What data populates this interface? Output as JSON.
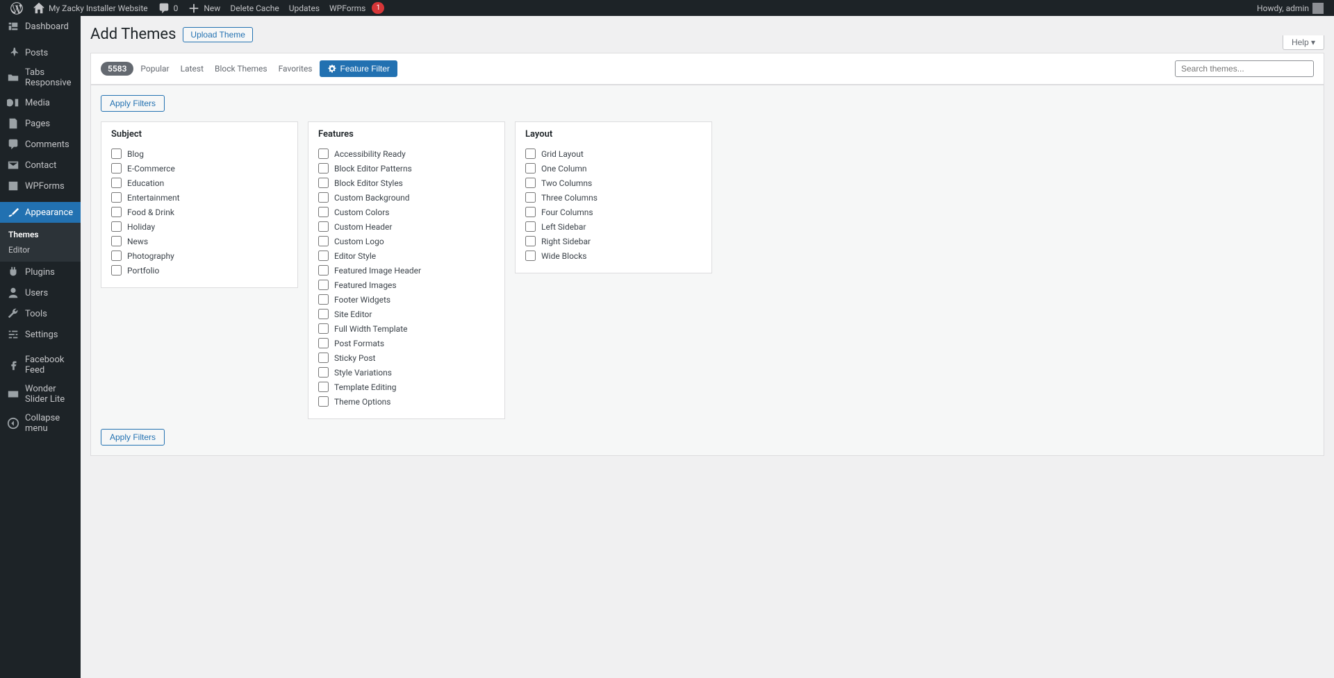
{
  "adminbar": {
    "site_name": "My Zacky Installer Website",
    "comments_count": "0",
    "new": "New",
    "delete_cache": "Delete Cache",
    "updates": "Updates",
    "wpforms": "WPForms",
    "wpforms_badge": "1",
    "howdy": "Howdy, admin"
  },
  "sidebar": {
    "dashboard": "Dashboard",
    "posts": "Posts",
    "tabs_responsive": "Tabs Responsive",
    "media": "Media",
    "pages": "Pages",
    "comments": "Comments",
    "contact": "Contact",
    "wpforms": "WPForms",
    "appearance": "Appearance",
    "appearance_sub": {
      "themes": "Themes",
      "editor": "Editor"
    },
    "plugins": "Plugins",
    "users": "Users",
    "tools": "Tools",
    "settings": "Settings",
    "facebook_feed": "Facebook Feed",
    "wonder_slider": "Wonder Slider Lite",
    "collapse": "Collapse menu"
  },
  "header": {
    "title": "Add Themes",
    "upload": "Upload Theme",
    "help": "Help"
  },
  "filterbar": {
    "count": "5583",
    "popular": "Popular",
    "latest": "Latest",
    "block_themes": "Block Themes",
    "favorites": "Favorites",
    "feature_filter": "Feature Filter",
    "search_placeholder": "Search themes..."
  },
  "filters": {
    "apply": "Apply Filters",
    "subject": {
      "heading": "Subject",
      "items": [
        "Blog",
        "E-Commerce",
        "Education",
        "Entertainment",
        "Food & Drink",
        "Holiday",
        "News",
        "Photography",
        "Portfolio"
      ]
    },
    "features": {
      "heading": "Features",
      "items": [
        "Accessibility Ready",
        "Block Editor Patterns",
        "Block Editor Styles",
        "Custom Background",
        "Custom Colors",
        "Custom Header",
        "Custom Logo",
        "Editor Style",
        "Featured Image Header",
        "Featured Images",
        "Footer Widgets",
        "Site Editor",
        "Full Width Template",
        "Post Formats",
        "Sticky Post",
        "Style Variations",
        "Template Editing",
        "Theme Options"
      ]
    },
    "layout": {
      "heading": "Layout",
      "items": [
        "Grid Layout",
        "One Column",
        "Two Columns",
        "Three Columns",
        "Four Columns",
        "Left Sidebar",
        "Right Sidebar",
        "Wide Blocks"
      ]
    }
  }
}
